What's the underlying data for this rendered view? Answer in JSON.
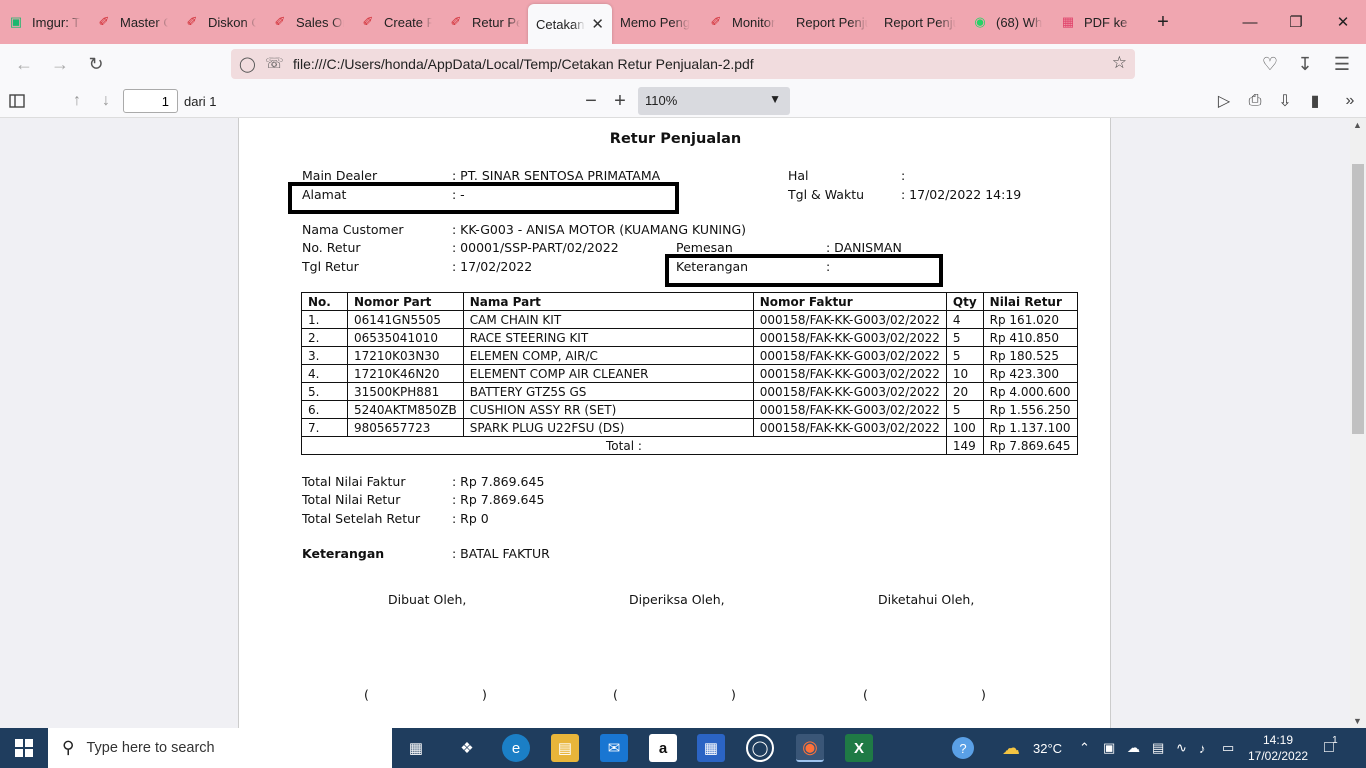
{
  "tabs": [
    {
      "label": "Imgur: Th",
      "icon": "imgur-icon",
      "active": false
    },
    {
      "label": "Master C",
      "icon": "honda-icon",
      "active": false
    },
    {
      "label": "Diskon C",
      "icon": "honda-icon",
      "active": false
    },
    {
      "label": "Sales Ord",
      "icon": "honda-icon",
      "active": false
    },
    {
      "label": "Create F",
      "icon": "honda-icon",
      "active": false
    },
    {
      "label": "Retur Pe",
      "icon": "honda-icon",
      "active": false
    },
    {
      "label": "Cetakan R",
      "icon": "none",
      "active": true
    },
    {
      "label": "Memo Peng",
      "icon": "none",
      "active": false
    },
    {
      "label": "Monitor",
      "icon": "honda-icon",
      "active": false
    },
    {
      "label": "Report Penju",
      "icon": "none",
      "active": false
    },
    {
      "label": "Report Penju",
      "icon": "none",
      "active": false
    },
    {
      "label": "(68) Wh",
      "icon": "whatsapp-icon",
      "active": false
    },
    {
      "label": "PDF ke K",
      "icon": "pdf-tool-icon",
      "active": false
    }
  ],
  "url": "file:///C:/Users/honda/AppData/Local/Temp/Cetakan Retur Penjualan-2.pdf",
  "pdf_toolbar": {
    "page_number": "1",
    "page_total": "dari 1",
    "zoom": "110%"
  },
  "document": {
    "title": "Retur Penjualan",
    "main_dealer_label": "Main Dealer",
    "main_dealer_value": ": PT. SINAR SENTOSA PRIMATAMA",
    "alamat_label": "Alamat",
    "alamat_value": ": -",
    "hal_label": "Hal",
    "hal_value": ":",
    "tgl_waktu_label": "Tgl & Waktu",
    "tgl_waktu_value": ": 17/02/2022 14:19",
    "customer_label": "Nama Customer",
    "customer_value": ": KK-G003 - ANISA MOTOR (KUAMANG KUNING)",
    "no_retur_label": "No. Retur",
    "no_retur_value": ": 00001/SSP-PART/02/2022",
    "tgl_retur_label": "Tgl Retur",
    "tgl_retur_value": ": 17/02/2022",
    "pemesan_label": "Pemesan",
    "pemesan_value": ": DANISMAN",
    "keterangan_label": "Keterangan",
    "keterangan_value": ":",
    "table_headers": [
      "No.",
      "Nomor Part",
      "Nama Part",
      "Nomor Faktur",
      "Qty",
      "Nilai Retur"
    ],
    "rows": [
      [
        "1.",
        "06141GN5505",
        "CAM CHAIN KIT",
        "000158/FAK-KK-G003/02/2022",
        "4",
        "Rp 161.020"
      ],
      [
        "2.",
        "06535041010",
        "RACE STEERING KIT",
        "000158/FAK-KK-G003/02/2022",
        "5",
        "Rp 410.850"
      ],
      [
        "3.",
        "17210K03N30",
        "ELEMEN COMP, AIR/C",
        "000158/FAK-KK-G003/02/2022",
        "5",
        "Rp 180.525"
      ],
      [
        "4.",
        "17210K46N20",
        "ELEMENT COMP AIR CLEANER",
        "000158/FAK-KK-G003/02/2022",
        "10",
        "Rp 423.300"
      ],
      [
        "5.",
        "31500KPH881",
        "BATTERY GTZ5S GS",
        "000158/FAK-KK-G003/02/2022",
        "20",
        "Rp 4.000.600"
      ],
      [
        "6.",
        "5240AKTM850ZB",
        "CUSHION ASSY RR (SET)",
        "000158/FAK-KK-G003/02/2022",
        "5",
        "Rp 1.556.250"
      ],
      [
        "7.",
        "9805657723",
        "SPARK PLUG U22FSU (DS)",
        "000158/FAK-KK-G003/02/2022",
        "100",
        "Rp 1.137.100"
      ]
    ],
    "total_label": "Total :",
    "total_qty": "149",
    "total_value": "Rp 7.869.645",
    "total_nilai_faktur_label": "Total Nilai Faktur",
    "total_nilai_faktur_value": ": Rp 7.869.645",
    "total_nilai_retur_label": "Total Nilai Retur",
    "total_nilai_retur_value": ": Rp 7.869.645",
    "total_setelah_retur_label": "Total Setelah Retur",
    "total_setelah_retur_value": ": Rp 0",
    "keterangan2_label": "Keterangan",
    "keterangan2_value": ": BATAL FAKTUR",
    "dibuat_oleh": "Dibuat Oleh,",
    "diperiksa_oleh": "Diperiksa Oleh,",
    "diketahui_oleh": "Diketahui Oleh,",
    "paren_open": "(",
    "paren_close": ")"
  },
  "taskbar": {
    "search_placeholder": "Type here to search",
    "weather": "32°C",
    "time": "14:19",
    "date": "17/02/2022",
    "notification_count": "1"
  },
  "colors": {
    "tabstrip": "#f0a6b0",
    "urlbar": "#f1dcde",
    "taskbar": "#1f3d5e",
    "highlight_box": "#000000"
  }
}
